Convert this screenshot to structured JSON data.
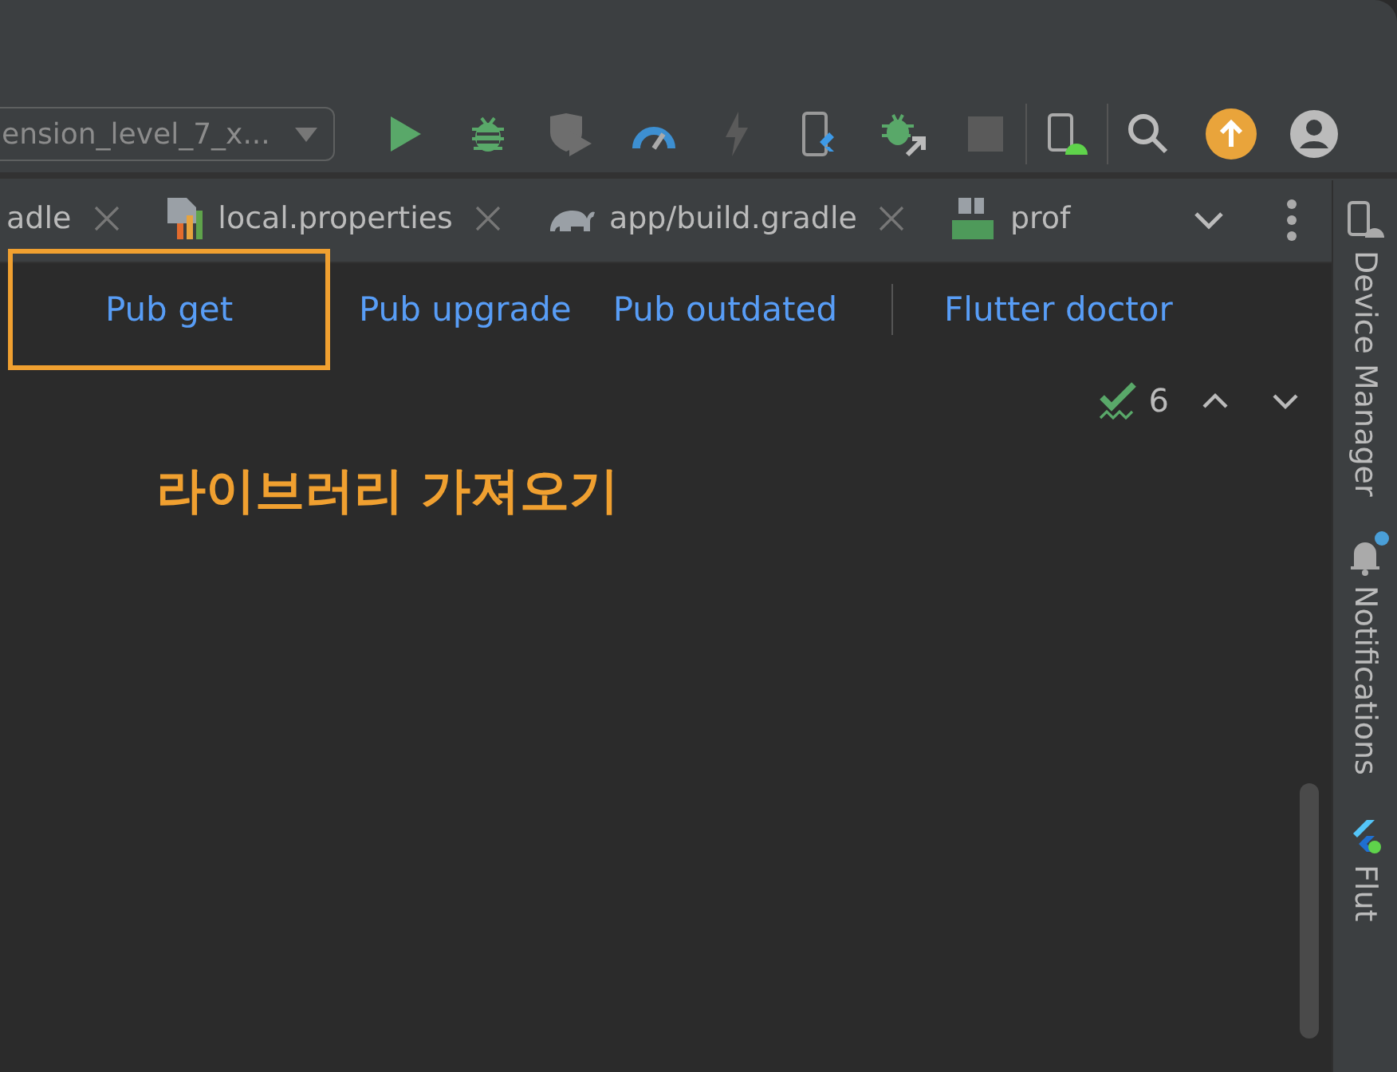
{
  "toolbar": {
    "run_config": "ension_level_7_x..."
  },
  "tabs": [
    {
      "label": "adle",
      "kind": "plain",
      "selected": false,
      "closable": true
    },
    {
      "label": "local.properties",
      "kind": "properties",
      "selected": false,
      "closable": true
    },
    {
      "label": "app/build.gradle",
      "kind": "gradle",
      "selected": false,
      "closable": true
    },
    {
      "label": "prof",
      "kind": "manifest",
      "selected": false,
      "closable": false
    }
  ],
  "action_bar": {
    "groups": [
      [
        {
          "label": "Pub get",
          "highlighted": true
        },
        {
          "label": "Pub upgrade",
          "highlighted": false
        },
        {
          "label": "Pub outdated",
          "highlighted": false
        }
      ],
      [
        {
          "label": "Flutter doctor",
          "highlighted": false
        }
      ]
    ]
  },
  "inspection": {
    "count": "6"
  },
  "annotation": {
    "text": "라이브러리 가져오기"
  },
  "side_tools": [
    {
      "label": "Device Manager",
      "kind": "device",
      "badge": false
    },
    {
      "label": "Notifications",
      "kind": "bell",
      "badge": true
    },
    {
      "label": "Flut",
      "kind": "flutter",
      "badge": false
    }
  ]
}
